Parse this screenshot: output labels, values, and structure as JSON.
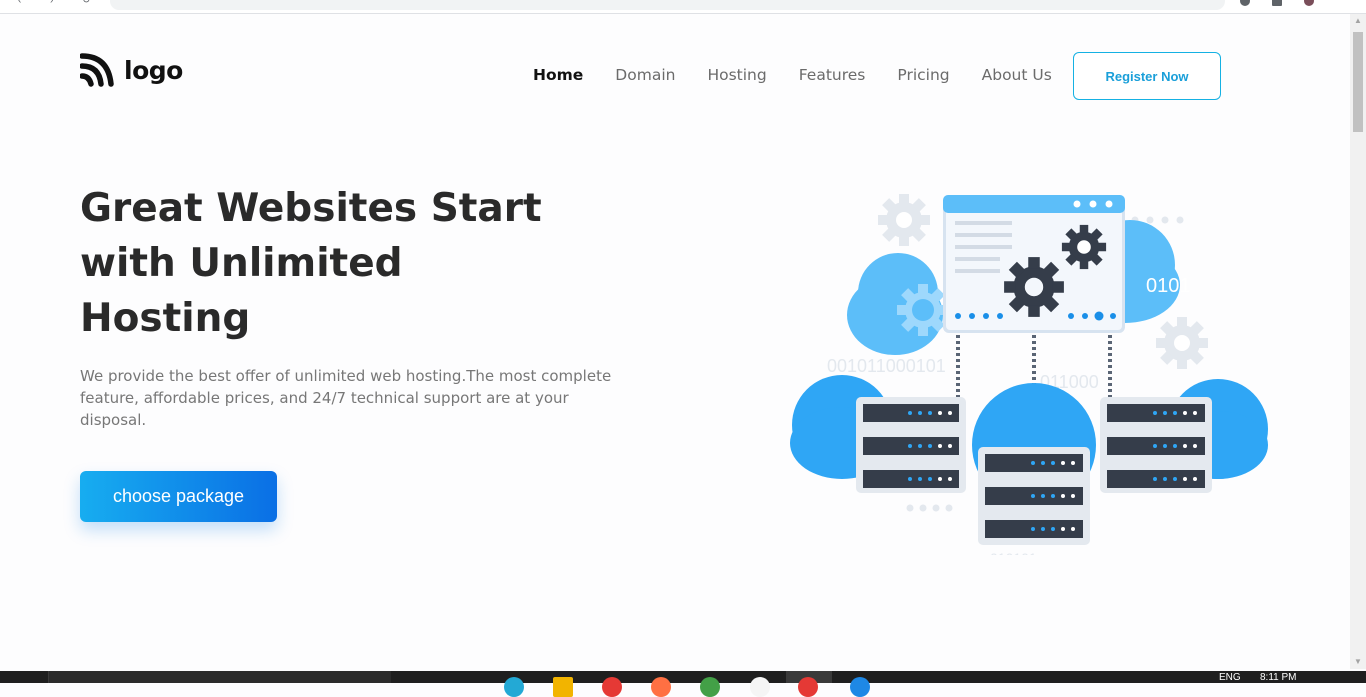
{
  "header": {
    "logo_text": "logo",
    "nav": [
      {
        "label": "Home",
        "active": true
      },
      {
        "label": "Domain"
      },
      {
        "label": "Hosting"
      },
      {
        "label": "Features"
      },
      {
        "label": "Pricing"
      },
      {
        "label": "About Us"
      }
    ],
    "register_label": "Register Now"
  },
  "hero": {
    "title": "Great Websites Start with Unlimited Hosting",
    "description": "We provide the best offer of unlimited web hosting.The most complete feature, affordable prices, and 24/7 technical support are at your disposal.",
    "cta_label": "choose package"
  },
  "illustration": {
    "binary_1": "0101",
    "binary_2": "001011000101",
    "binary_3": "011000",
    "binary_4": "010101"
  },
  "taskbar": {
    "language": "ENG",
    "time": "8:11 PM"
  },
  "colors": {
    "accent": "#15b1e3",
    "cta_start": "#17adf0",
    "cta_end": "#0a6fe5",
    "cloud": "#2fa6f5",
    "dark": "#353d4a"
  }
}
